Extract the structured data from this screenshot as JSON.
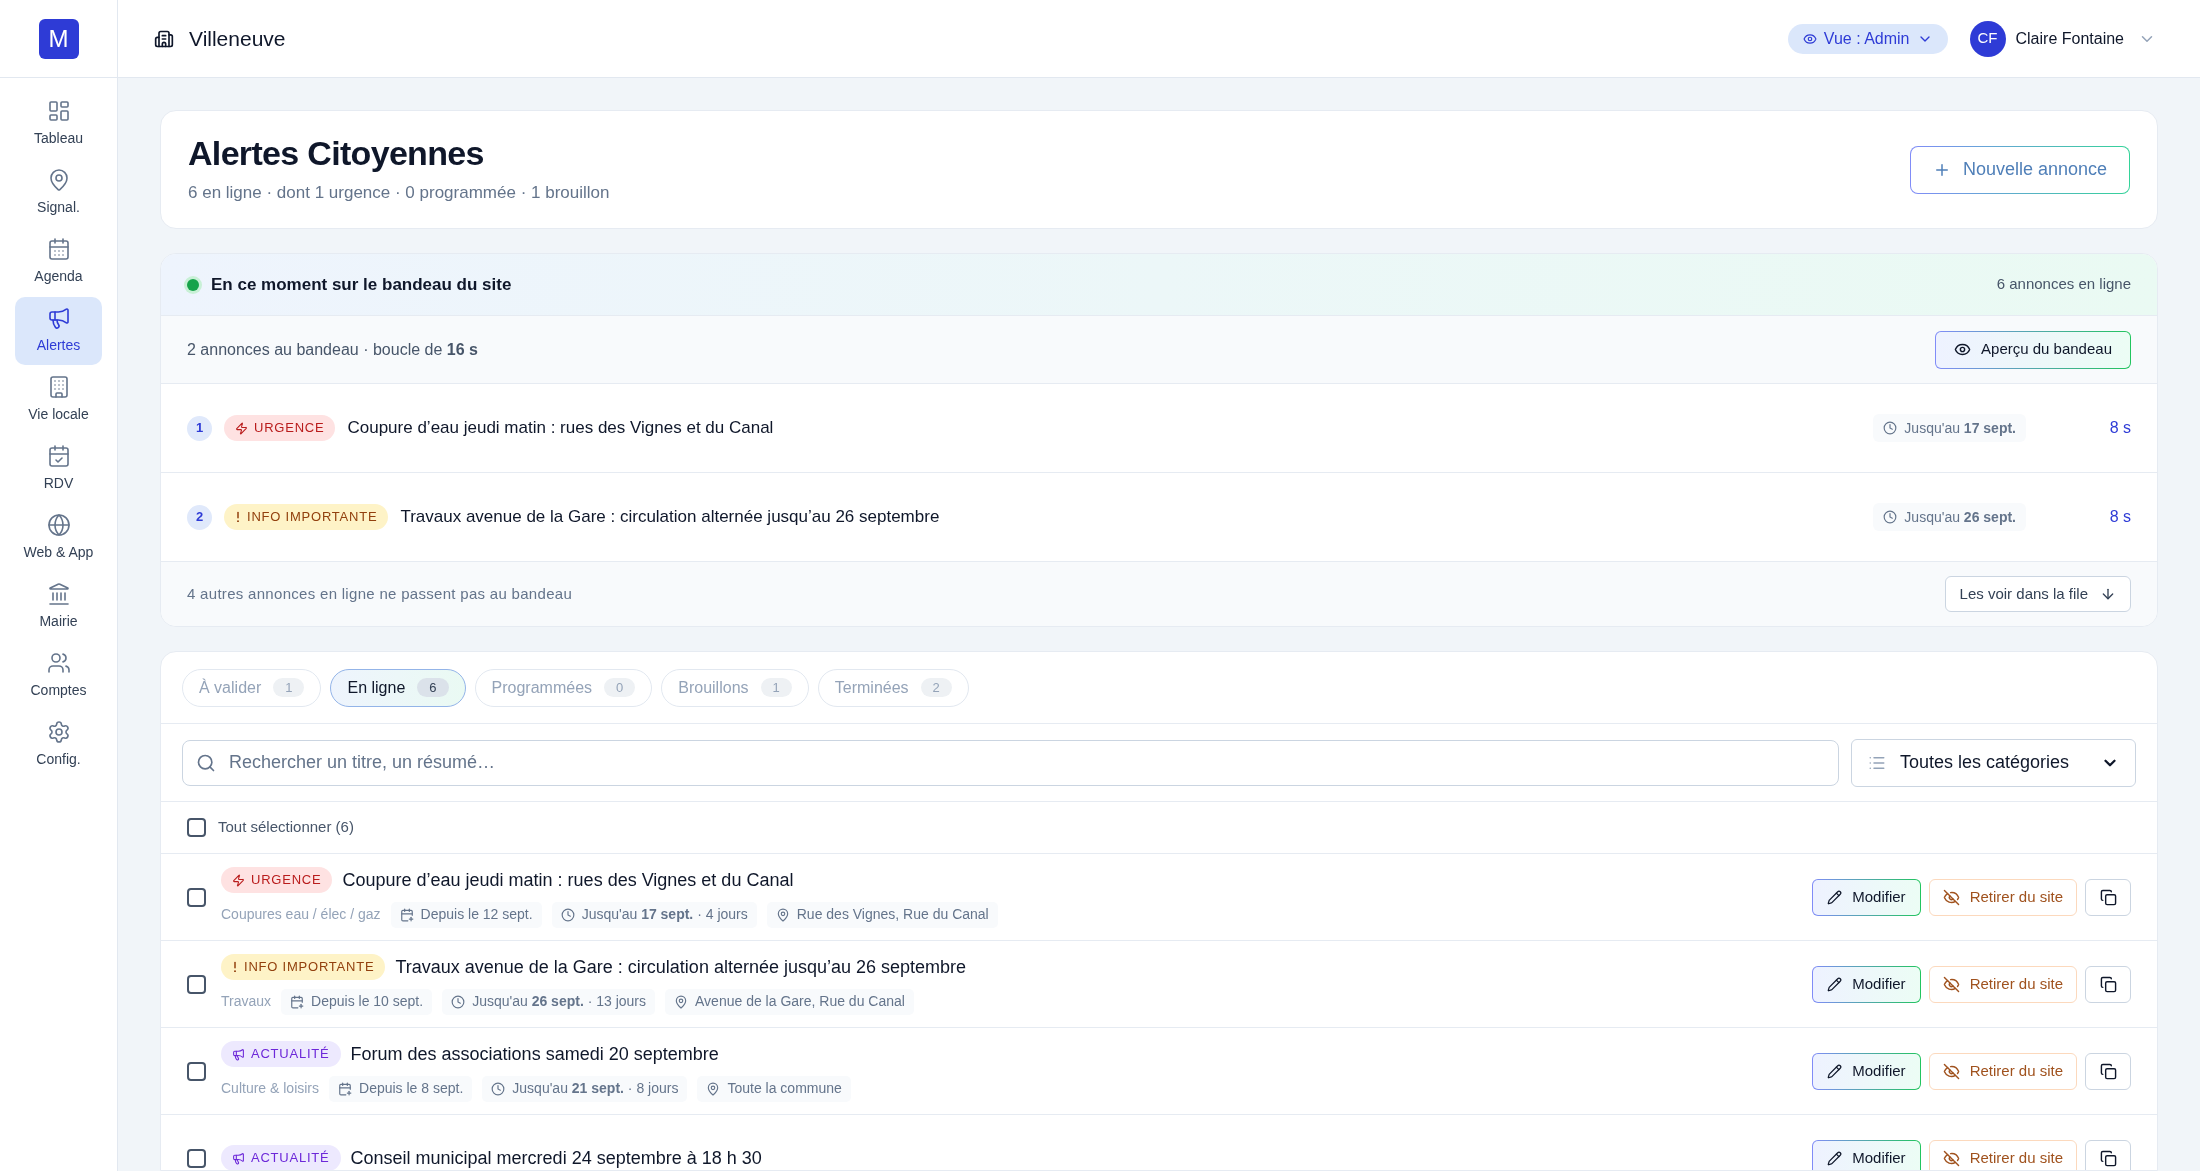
{
  "logo": "M",
  "sidebar": {
    "items": [
      {
        "label": "Tableau",
        "selected": false
      },
      {
        "label": "Signal.",
        "selected": false
      },
      {
        "label": "Agenda",
        "selected": false
      },
      {
        "label": "Alertes",
        "selected": true
      },
      {
        "label": "Vie locale",
        "selected": false
      },
      {
        "label": "RDV",
        "selected": false
      },
      {
        "label": "Web & App",
        "selected": false
      },
      {
        "label": "Mairie",
        "selected": false
      },
      {
        "label": "Comptes",
        "selected": false
      },
      {
        "label": "Config.",
        "selected": false
      }
    ]
  },
  "header": {
    "commune": "Villeneuve",
    "view": "Vue : Admin",
    "avatar": "CF",
    "user": "Claire Fontaine"
  },
  "page": {
    "title": "Alertes Citoyennes",
    "subtitle": "6 en ligne · dont 1 urgence · 0 programmée · 1 brouillon",
    "new_button": "Nouvelle annonce"
  },
  "banner": {
    "title": "En ce moment sur le bandeau du site",
    "count": "6 annonces en ligne",
    "summary": "2 annonces au bandeau · boucle de **16 s**",
    "preview_button": "Aperçu du bandeau",
    "items": [
      {
        "number": "1",
        "kind": "urgence",
        "badge": "URGENCE",
        "title": "Coupure d’eau jeudi matin : rues des Vignes et du Canal",
        "until": "Jusqu'au **17 sept.**",
        "duration": "8 s"
      },
      {
        "number": "2",
        "kind": "info",
        "badge": "INFO IMPORTANTE",
        "title": "Travaux avenue de la Gare : circulation alternée jusqu’au 26 septembre",
        "until": "Jusqu'au **26 sept.**",
        "duration": "8 s"
      }
    ],
    "footer": "4 autres annonces en ligne ne passent pas au bandeau",
    "footer_button": "Les voir dans la file"
  },
  "tabs": [
    {
      "label": "À valider",
      "count": "1",
      "selected": false
    },
    {
      "label": "En ligne",
      "count": "6",
      "selected": true
    },
    {
      "label": "Programmées",
      "count": "0",
      "selected": false
    },
    {
      "label": "Brouillons",
      "count": "1",
      "selected": false
    },
    {
      "label": "Terminées",
      "count": "2",
      "selected": false
    }
  ],
  "search": {
    "placeholder": "Rechercher un titre, un résumé…"
  },
  "category_select": {
    "value": "Toutes les catégories"
  },
  "select_all": {
    "label": "Tout sélectionner (6)",
    "checked": false
  },
  "rows": [
    {
      "kind": "urgence",
      "badge": "URGENCE",
      "title": "Coupure d’eau jeudi matin : rues des Vignes et du Canal",
      "category": "Coupures eau / élec / gaz",
      "since": "Depuis le 12 sept.",
      "until": "Jusqu'au **17 sept.** · 4 jours",
      "place": "Rue des Vignes, Rue du Canal",
      "checked": false,
      "edit": "Modifier",
      "remove": "Retirer du site"
    },
    {
      "kind": "info",
      "badge": "INFO IMPORTANTE",
      "title": "Travaux avenue de la Gare : circulation alternée jusqu’au 26 septembre",
      "category": "Travaux",
      "since": "Depuis le 10 sept.",
      "until": "Jusqu'au **26 sept.** · 13 jours",
      "place": "Avenue de la Gare, Rue du Canal",
      "checked": false,
      "edit": "Modifier",
      "remove": "Retirer du site"
    },
    {
      "kind": "actualite",
      "badge": "ACTUALITÉ",
      "title": "Forum des associations samedi 20 septembre",
      "category": "Culture & loisirs",
      "since": "Depuis le 8 sept.",
      "until": "Jusqu'au **21 sept.** · 8 jours",
      "place": "Toute la commune",
      "checked": false,
      "edit": "Modifier",
      "remove": "Retirer du site"
    },
    {
      "kind": "actualite",
      "badge": "ACTUALITÉ",
      "title": "Conseil municipal mercredi 24 septembre à 18 h 30",
      "checked": false,
      "edit": "Modifier",
      "remove": "Retirer du site"
    }
  ]
}
